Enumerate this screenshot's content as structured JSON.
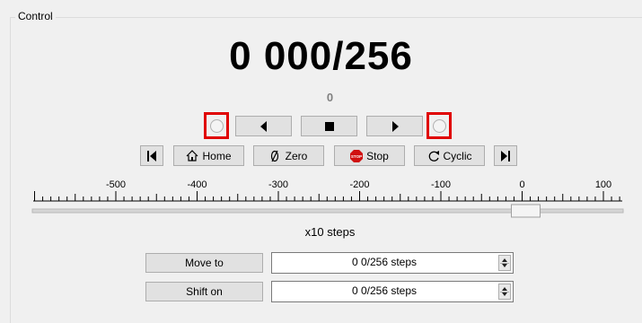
{
  "group_title": "Control",
  "position": {
    "main": "0 000/256",
    "sub": "0"
  },
  "jog": {
    "left_radio_selected": false,
    "right_radio_selected": false
  },
  "buttons": {
    "home": "Home",
    "zero": "Zero",
    "stop": "Stop",
    "cyclic": "Cyclic"
  },
  "stop_icon_text": "STOP",
  "scale": {
    "ticks": [
      "-500",
      "-400",
      "-300",
      "-200",
      "-100",
      "0",
      "100"
    ],
    "slider_value": 0
  },
  "unit_label": "x10  steps",
  "move_to": {
    "button": "Move to",
    "value": "0 0/256 steps"
  },
  "shift_on": {
    "button": "Shift on",
    "value": "0 0/256 steps"
  },
  "colors": {
    "highlight": "#e00000",
    "stop_icon": "#d01010",
    "button_bg": "#e1e1e1"
  }
}
